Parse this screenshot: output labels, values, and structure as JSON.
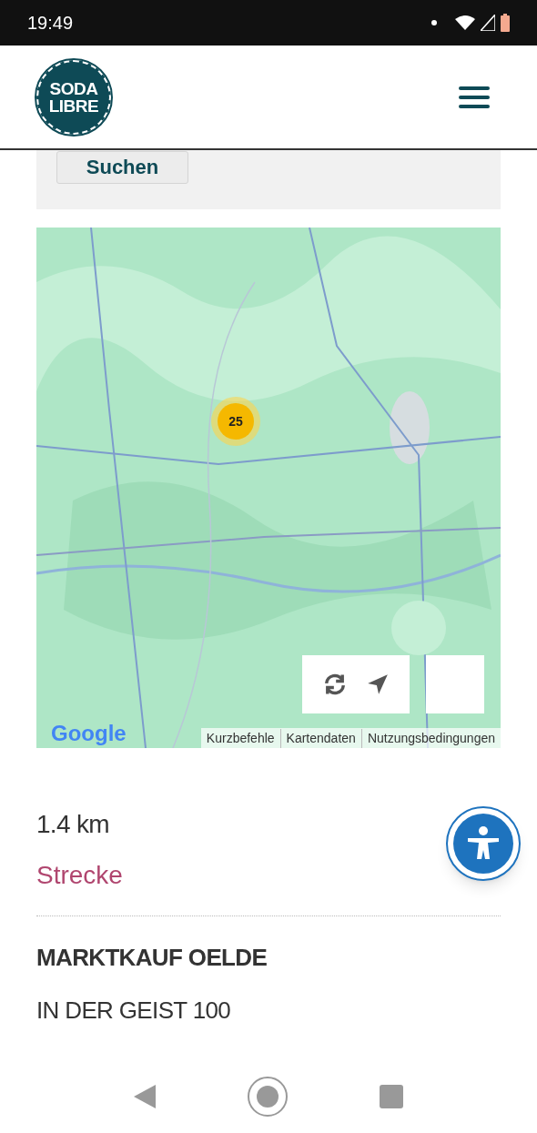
{
  "status_bar": {
    "time": "19:49"
  },
  "header": {
    "logo": {
      "line_1": "SODA",
      "line_2": "LIBRE"
    }
  },
  "search_panel": {
    "button": "Suchen"
  },
  "map": {
    "cluster": {
      "count": "25"
    },
    "logo": "Google",
    "attribution": [
      "Kurzbefehle",
      "Kartendaten",
      "Nutzungsbedingungen"
    ]
  },
  "result": {
    "distance": "1.4 km",
    "route_link": "Strecke",
    "name": "MARKTKAUF OELDE",
    "address": "IN DER GEIST 100"
  }
}
